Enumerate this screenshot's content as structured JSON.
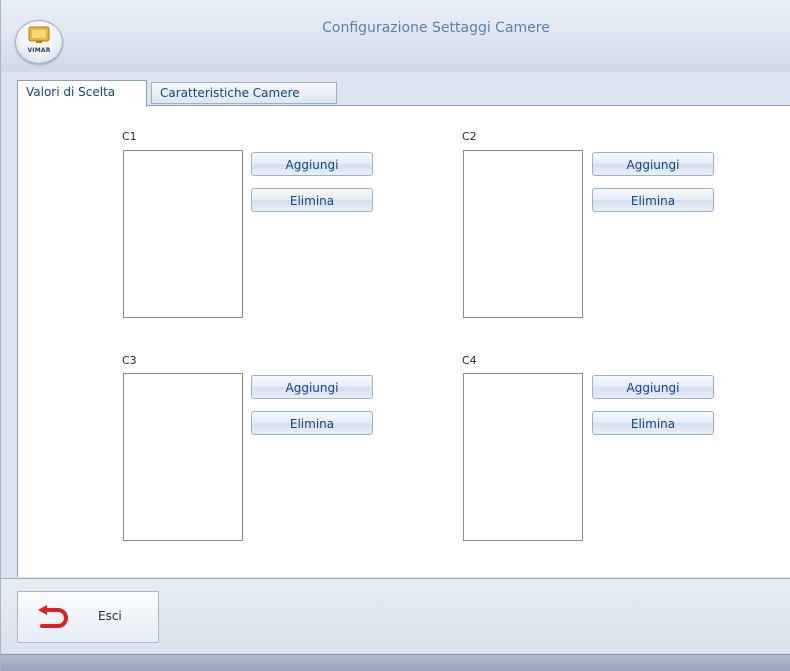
{
  "window": {
    "title": "Configurazione Settaggi Camere",
    "logo_text": "VIMAR"
  },
  "tabs": [
    {
      "label": "Valori di Scelta",
      "active": true
    },
    {
      "label": "Caratteristiche Camere",
      "active": false
    }
  ],
  "groups": [
    {
      "label": "C1",
      "add_label": "Aggiungi",
      "delete_label": "Elimina"
    },
    {
      "label": "C2",
      "add_label": "Aggiungi",
      "delete_label": "Elimina"
    },
    {
      "label": "C3",
      "add_label": "Aggiungi",
      "delete_label": "Elimina"
    },
    {
      "label": "C4",
      "add_label": "Aggiungi",
      "delete_label": "Elimina"
    }
  ],
  "footer": {
    "exit_label": "Esci",
    "exit_icon": "undo-arrow-icon",
    "exit_icon_color": "#e02020"
  },
  "colors": {
    "accent_text": "#15428b",
    "title_text": "#5c7fb0"
  }
}
